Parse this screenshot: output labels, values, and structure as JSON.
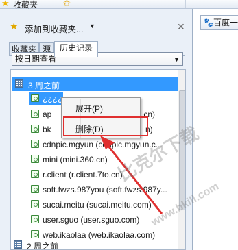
{
  "toolbar": {
    "favorites_label": "收藏夹"
  },
  "panel": {
    "add_to_favorites": "添加到收藏夹..."
  },
  "tabs": [
    {
      "label": "收藏夹"
    },
    {
      "label": "源"
    },
    {
      "label": "历史记录"
    }
  ],
  "view_select": {
    "value": "按日期查看"
  },
  "history": {
    "groups": [
      {
        "label": "3 周之前"
      },
      {
        "label": "2 周之前"
      }
    ],
    "items": [
      {
        "label": "¿¿¿¿"
      },
      {
        "label": "ap"
      },
      {
        "label": "bk"
      },
      {
        "label": "cdnpic.mgyun (cdnpic.mgyun.c..."
      },
      {
        "label": "mini (mini.360.cn)"
      },
      {
        "label": "r.client (r.client.7to.cn)"
      },
      {
        "label": "soft.fwzs.987you (soft.fwzs.987y..."
      },
      {
        "label": "sucai.meitu (sucai.meitu.com)"
      },
      {
        "label": "user.sguo (user.sguo.com)"
      },
      {
        "label": "web.ikaolaa (web.ikaolaa.com)"
      }
    ],
    "partial_suffix_1": ".cn)",
    "partial_suffix_2": "n)"
  },
  "context_menu": {
    "expand": "展开(P)",
    "delete": "删除(D)"
  },
  "browser_tab": {
    "label": "百度一"
  },
  "watermark": {
    "text": "比克尔下载",
    "url": "www.bkill.com"
  },
  "colors": {
    "selection": "#3399ff",
    "highlight_box": "#e02f2f",
    "arrow": "#e02f2f"
  },
  "icons": {
    "favorites": "star-icon",
    "add": "star-add-icon",
    "group": "calendar-icon",
    "page": "page-icon",
    "tab": "paw-icon"
  }
}
